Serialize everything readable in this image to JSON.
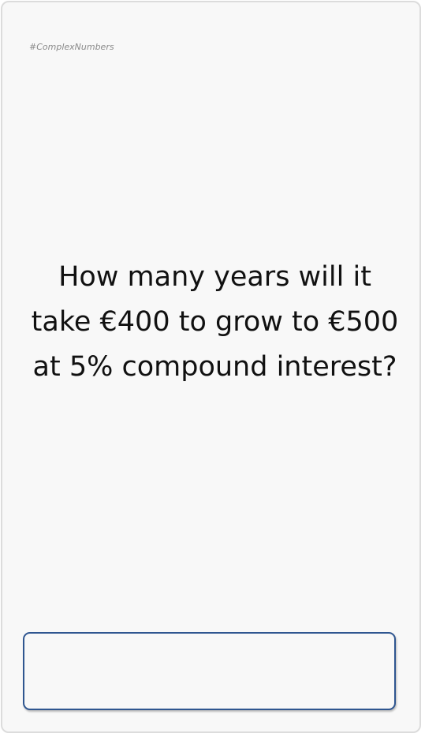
{
  "card": {
    "tag": "#ComplexNumbers",
    "question_lines": [
      "How many years will it",
      "take €400 to grow to €500",
      "at 5% compound interest?"
    ]
  },
  "answer": {
    "value": "",
    "placeholder": ""
  }
}
